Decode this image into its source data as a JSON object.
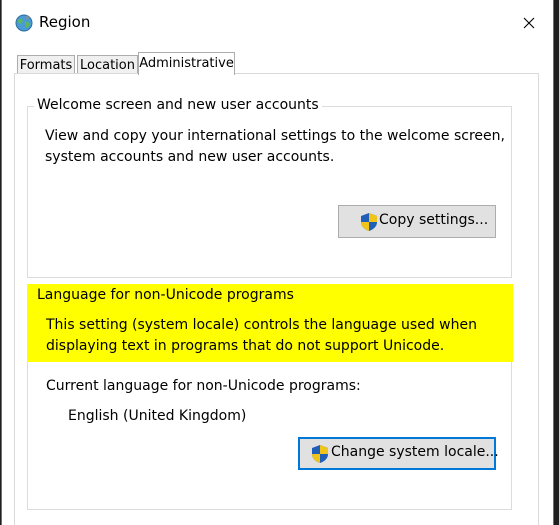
{
  "window": {
    "title": "Region",
    "app_icon": "globe-icon",
    "close_icon": "close-icon"
  },
  "tabs": [
    {
      "label": "Formats",
      "active": false
    },
    {
      "label": "Location",
      "active": false
    },
    {
      "label": "Administrative",
      "active": true
    }
  ],
  "welcome_group": {
    "legend": "Welcome screen and new user accounts",
    "description_line1": "View and copy your international settings to the welcome screen,",
    "description_line2": "system accounts and new user accounts.",
    "button_label": "Copy settings...",
    "button_icon": "uac-shield-icon"
  },
  "locale_group": {
    "legend": "Language for non-Unicode programs",
    "description_line1": "This setting (system locale) controls the language used when",
    "description_line2": "displaying text in programs that do not support Unicode.",
    "current_label": "Current language for non-Unicode programs:",
    "current_value": "English (United Kingdom)",
    "button_label": "Change system locale...",
    "button_icon": "uac-shield-icon",
    "highlight_color": "#ffff00"
  }
}
